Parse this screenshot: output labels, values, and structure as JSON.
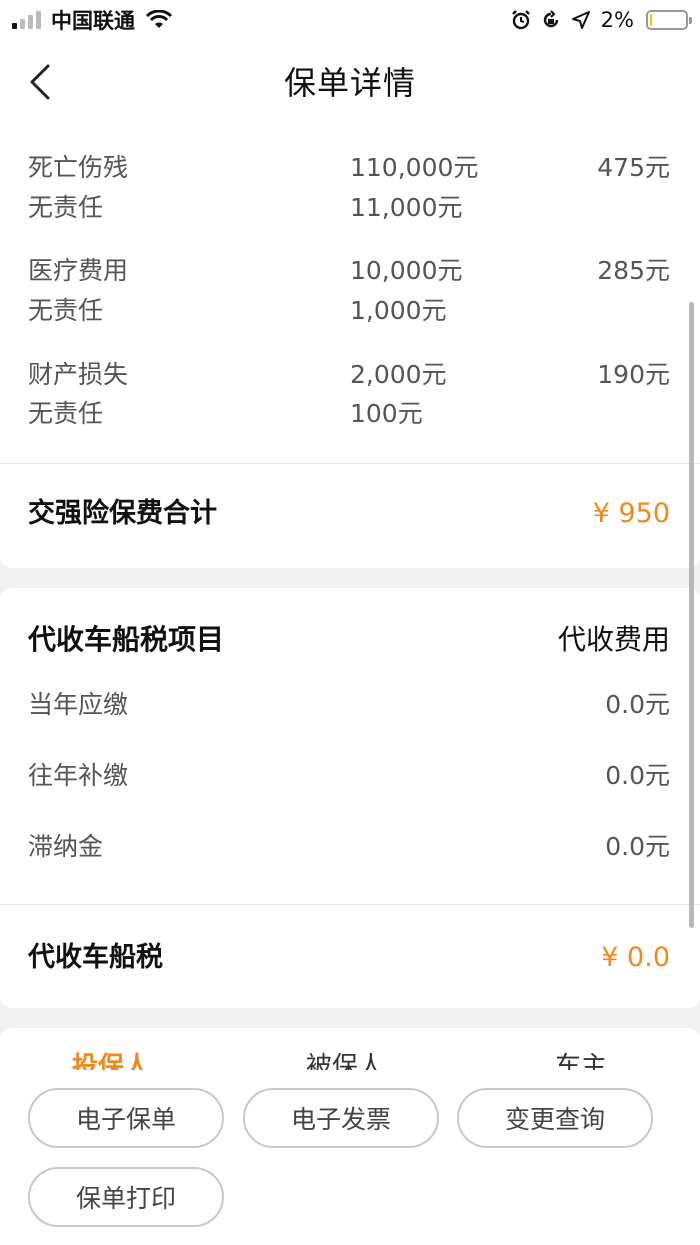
{
  "status_bar": {
    "carrier": "中国联通",
    "battery_text": "2%",
    "battery_level": 0.02
  },
  "nav": {
    "title": "保单详情"
  },
  "coverage": [
    {
      "name": "死亡伤残",
      "amount": "110,000元",
      "premium": "475元"
    },
    {
      "name": "无责任",
      "amount": "11,000元",
      "premium": ""
    },
    {
      "name": "医疗费用",
      "amount": "10,000元",
      "premium": "285元"
    },
    {
      "name": "无责任",
      "amount": "1,000元",
      "premium": ""
    },
    {
      "name": "财产损失",
      "amount": "2,000元",
      "premium": "190元"
    },
    {
      "name": "无责任",
      "amount": "100元",
      "premium": ""
    }
  ],
  "compulsory_total": {
    "label": "交强险保费合计",
    "value": "¥ 950"
  },
  "tax": {
    "header_left": "代收车船税项目",
    "header_right": "代收费用",
    "rows": [
      {
        "label": "当年应缴",
        "value": "0.0元"
      },
      {
        "label": "往年补缴",
        "value": "0.0元"
      },
      {
        "label": "滞纳金",
        "value": "0.0元"
      }
    ],
    "total_label": "代收车船税",
    "total_value": "¥ 0.0"
  },
  "tabs": [
    "投保人",
    "被保人",
    "车主"
  ],
  "actions": {
    "e_policy": "电子保单",
    "e_invoice": "电子发票",
    "change_query": "变更查询",
    "print_policy": "保单打印"
  },
  "colors": {
    "accent": "#f08a1c"
  }
}
